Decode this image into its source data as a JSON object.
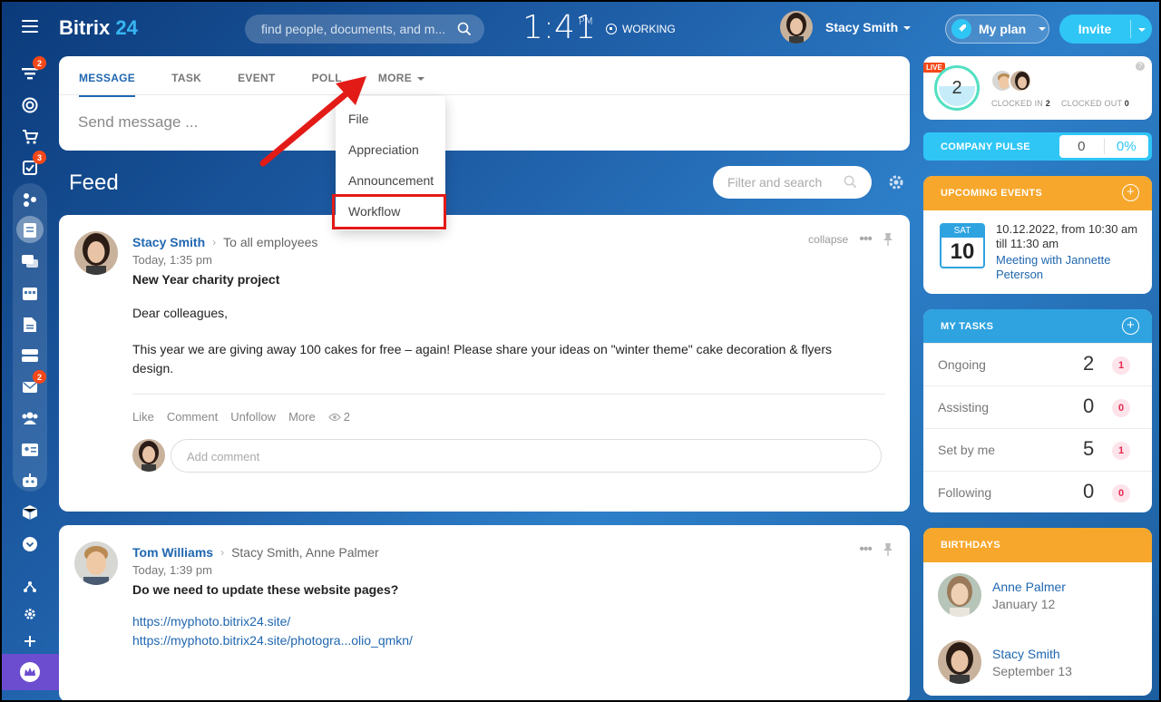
{
  "app": {
    "logo_text": "Bitrix",
    "logo_num": "24"
  },
  "header": {
    "search_placeholder": "find people, documents, and m...",
    "time": "1:41",
    "ampm": "PM",
    "status": "WORKING",
    "user_name": "Stacy Smith",
    "plan_label": "My plan",
    "invite_label": "Invite"
  },
  "sidebar": {
    "badges": {
      "feed": "2",
      "tasks": "3",
      "mail": "2"
    }
  },
  "composer": {
    "tabs": [
      "MESSAGE",
      "TASK",
      "EVENT",
      "POLL",
      "MORE"
    ],
    "placeholder": "Send message ..."
  },
  "more_menu": {
    "items": [
      "File",
      "Appreciation",
      "Announcement",
      "Workflow"
    ],
    "highlighted": "Workflow"
  },
  "feed": {
    "title": "Feed",
    "filter_placeholder": "Filter and search"
  },
  "posts": [
    {
      "author": "Stacy Smith",
      "recipients": "To all employees",
      "time": "Today, 1:35 pm",
      "title": "New Year charity project",
      "body_1": "Dear colleagues,",
      "body_2": "This year we are giving away 100 cakes for free – again! Please share your ideas on \"winter theme\" cake decoration & flyers design.",
      "collapse": "collapse",
      "actions": [
        "Like",
        "Comment",
        "Unfollow",
        "More"
      ],
      "views": "2",
      "comment_placeholder": "Add comment"
    },
    {
      "author": "Tom Williams",
      "recipients": "Stacy Smith, Anne Palmer",
      "time": "Today, 1:39 pm",
      "title": "Do we need to update these website pages?",
      "link_1": "https://myphoto.bitrix24.site/",
      "link_2": "https://myphoto.bitrix24.site/photogra...olio_qmkn/"
    }
  ],
  "timeman": {
    "live": "LIVE",
    "count": "2",
    "clocked_in_label": "CLOCKED IN",
    "clocked_in": "2",
    "clocked_out_label": "CLOCKED OUT",
    "clocked_out": "0"
  },
  "pulse": {
    "label": "COMPANY PULSE",
    "value": "0",
    "percent": "0%"
  },
  "events": {
    "label": "UPCOMING EVENTS",
    "dow": "SAT",
    "day": "10",
    "when": "10.12.2022, from 10:30 am till 11:30 am",
    "title": "Meeting with Jannette Peterson"
  },
  "tasks": {
    "label": "MY TASKS",
    "rows": [
      {
        "label": "Ongoing",
        "value": "2",
        "badge": "1"
      },
      {
        "label": "Assisting",
        "value": "0",
        "badge": "0"
      },
      {
        "label": "Set by me",
        "value": "5",
        "badge": "1"
      },
      {
        "label": "Following",
        "value": "0",
        "badge": "0"
      }
    ]
  },
  "birthdays": {
    "label": "BIRTHDAYS",
    "people": [
      {
        "name": "Anne Palmer",
        "date": "January 12"
      },
      {
        "name": "Stacy Smith",
        "date": "September 13"
      }
    ]
  },
  "colors": {
    "accent": "#2fc6f6",
    "link": "#2067b0",
    "orange": "#f7a72b",
    "highlight": "#e31b17"
  }
}
